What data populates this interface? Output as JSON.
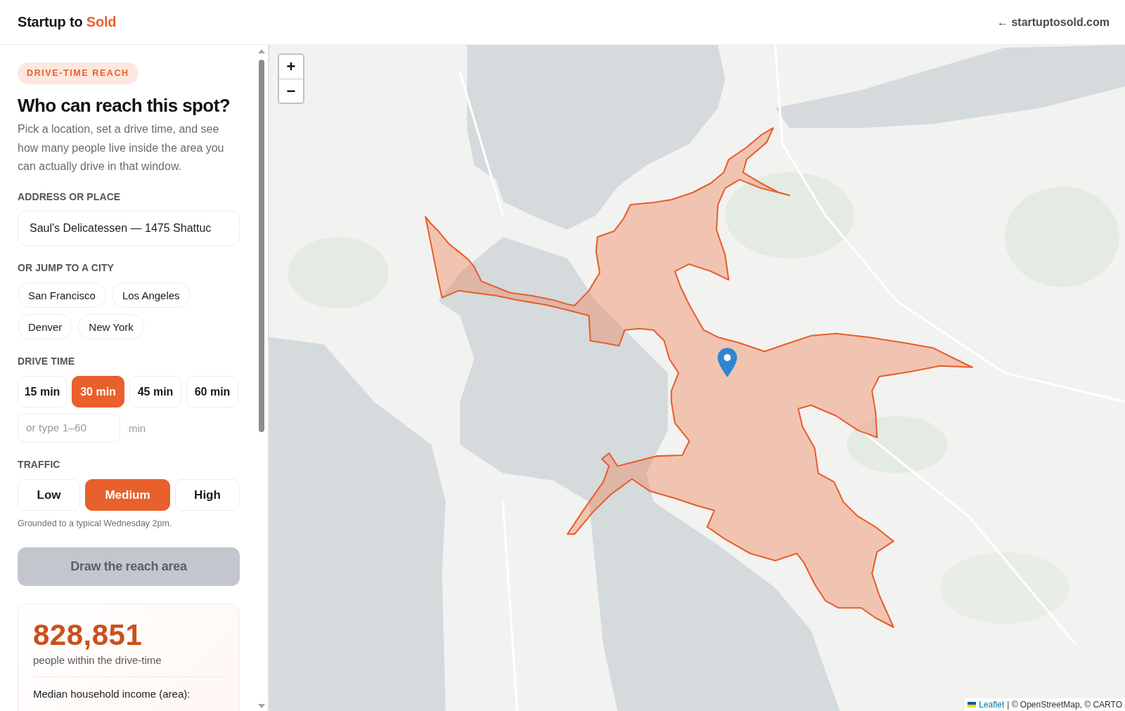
{
  "header": {
    "brand": {
      "text": "Startup to",
      "accent": "Sold"
    },
    "link": "← startuptosold.com"
  },
  "sidebar": {
    "badge": "DRIVE-TIME REACH",
    "title": "Who can reach this spot?",
    "intro": "Pick a location, set a drive time, and see how many people live inside the area you can actually drive in that window.",
    "address": {
      "label": "ADDRESS OR PLACE",
      "value": "Saul's Delicatessen — 1475 Shattuc"
    },
    "cities": {
      "label": "OR JUMP TO A CITY",
      "items": [
        "San Francisco",
        "Los Angeles",
        "Denver",
        "New York"
      ]
    },
    "drive_time": {
      "label": "DRIVE TIME",
      "options": [
        {
          "label": "15 min",
          "selected": false
        },
        {
          "label": "30 min",
          "selected": true
        },
        {
          "label": "45 min",
          "selected": false
        },
        {
          "label": "60 min",
          "selected": false
        }
      ],
      "custom": {
        "placeholder": "or type 1–60",
        "unit": "min"
      }
    },
    "traffic": {
      "label": "TRAFFIC",
      "options": [
        {
          "label": "Low",
          "selected": false
        },
        {
          "label": "Medium",
          "selected": true
        },
        {
          "label": "High",
          "selected": false
        }
      ],
      "note": "Grounded to a typical Wednesday 2pm."
    },
    "draw_button": {
      "label": "Draw the reach area",
      "disabled": true
    },
    "result": {
      "population": "828,851",
      "caption": "people within the drive-time",
      "income_label": "Median household income (area):"
    }
  },
  "map": {
    "zoom_in": "+",
    "zoom_out": "−",
    "attribution": {
      "link": "Leaflet",
      "text": "| © OpenStreetMap, © CARTO"
    }
  }
}
